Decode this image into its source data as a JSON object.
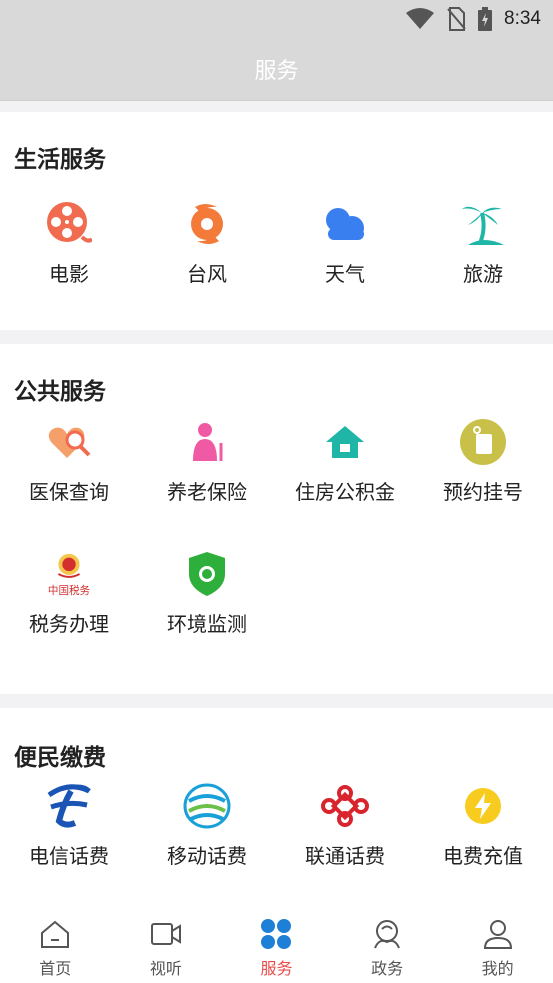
{
  "status": {
    "time": "8:34"
  },
  "header": {
    "title": "服务"
  },
  "sections": [
    {
      "title": "生活服务",
      "items": [
        {
          "label": "电影",
          "icon": "film-reel-icon"
        },
        {
          "label": "台风",
          "icon": "typhoon-icon"
        },
        {
          "label": "天气",
          "icon": "cloud-icon"
        },
        {
          "label": "旅游",
          "icon": "palm-tree-icon"
        }
      ]
    },
    {
      "title": "公共服务",
      "items": [
        {
          "label": "医保查询",
          "icon": "medical-search-icon"
        },
        {
          "label": "养老保险",
          "icon": "elderly-icon"
        },
        {
          "label": "住房公积金",
          "icon": "house-icon"
        },
        {
          "label": "预约挂号",
          "icon": "appointment-icon"
        },
        {
          "label": "税务办理",
          "icon": "tax-emblem-icon",
          "emblem_text": "中国税务"
        },
        {
          "label": "环境监测",
          "icon": "environment-emblem-icon"
        }
      ]
    },
    {
      "title": "便民缴费",
      "items": [
        {
          "label": "电信话费",
          "icon": "telecom-logo-icon"
        },
        {
          "label": "移动话费",
          "icon": "mobile-logo-icon"
        },
        {
          "label": "联通话费",
          "icon": "unicom-logo-icon"
        },
        {
          "label": "电费充值",
          "icon": "lightning-icon"
        }
      ]
    }
  ],
  "tabs": [
    {
      "label": "首页",
      "icon": "home-icon",
      "active": false
    },
    {
      "label": "视听",
      "icon": "video-camera-icon",
      "active": false
    },
    {
      "label": "服务",
      "icon": "grid-dots-icon",
      "active": true
    },
    {
      "label": "政务",
      "icon": "government-icon",
      "active": false
    },
    {
      "label": "我的",
      "icon": "user-icon",
      "active": false
    }
  ],
  "colors": {
    "accent": "#e94b4b",
    "tab_active_icon": "#1e7fd6",
    "header_bg": "#d9d9d9"
  }
}
